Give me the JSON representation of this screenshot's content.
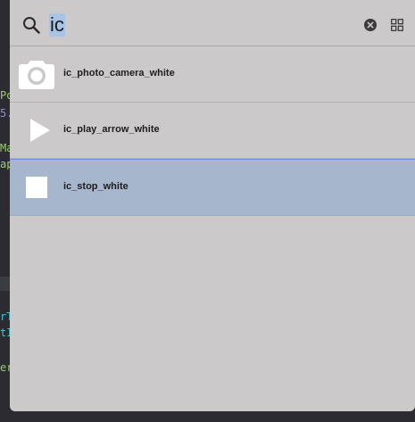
{
  "search": {
    "query": "ic",
    "clear_icon": "clear-circle-icon",
    "view_toggle_icon": "grid-view-icon"
  },
  "results": [
    {
      "label": "ic_photo_camera_white",
      "icon": "photo-camera-icon",
      "selected": false
    },
    {
      "label": "ic_play_arrow_white",
      "icon": "play-arrow-icon",
      "selected": false
    },
    {
      "label": "ic_stop_white",
      "icon": "stop-icon",
      "selected": true
    }
  ],
  "background_code": [
    "Po",
    "5.",
    "Ma",
    "ap",
    "rT",
    "tI",
    "er"
  ],
  "colors": {
    "panel": "#cbc9c9",
    "selection": "#a6b6cc",
    "selection_border": "#6f8fd4",
    "query_highlight": "#a7c3e6",
    "editor_bg": "#2b2b31"
  }
}
